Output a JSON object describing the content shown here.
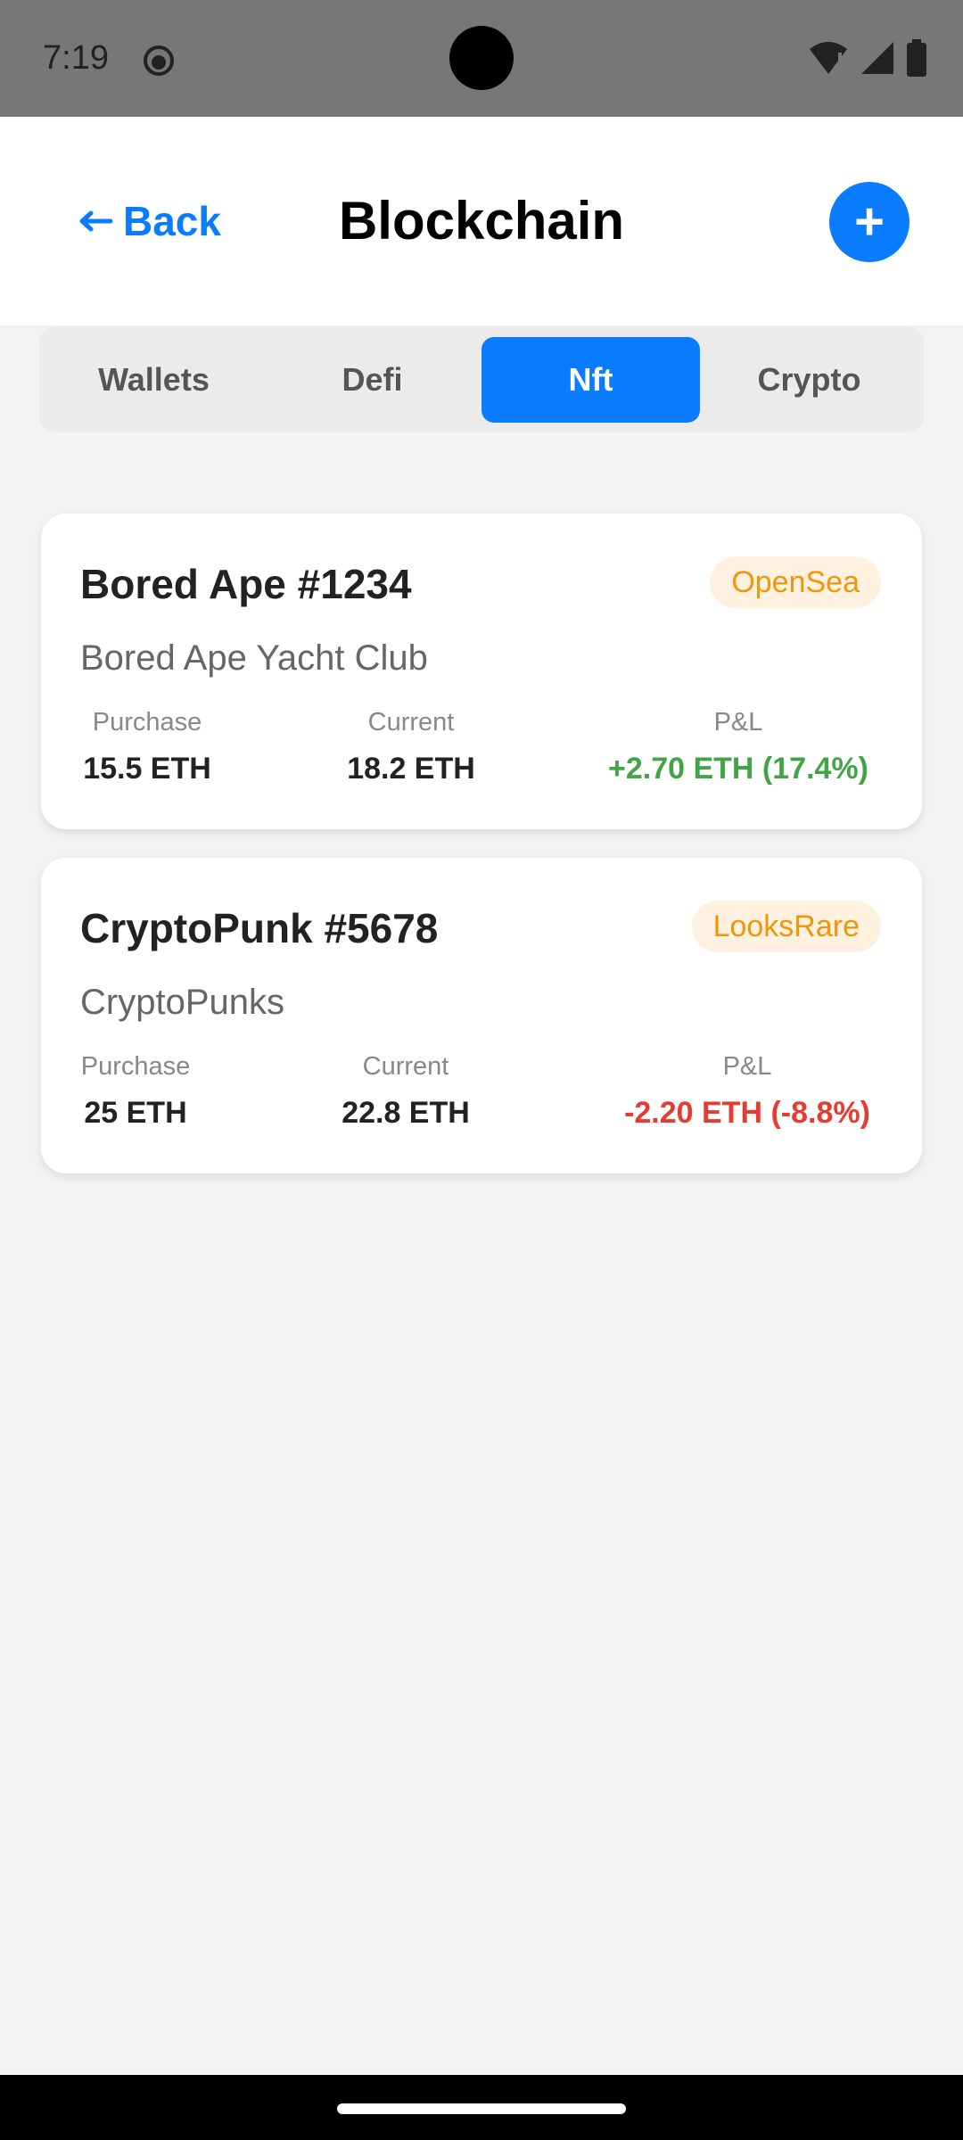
{
  "status_bar": {
    "time": "7:19"
  },
  "header": {
    "back_label": "Back",
    "title": "Blockchain",
    "add_label": "+"
  },
  "tabs": [
    {
      "label": "Wallets",
      "active": false
    },
    {
      "label": "Defi",
      "active": false
    },
    {
      "label": "Nft",
      "active": true
    },
    {
      "label": "Crypto",
      "active": false
    }
  ],
  "nfts": [
    {
      "name": "Bored Ape #1234",
      "marketplace": "OpenSea",
      "collection": "Bored Ape Yacht Club",
      "purchase_label": "Purchase",
      "purchase_value": "15.5 ETH",
      "current_label": "Current",
      "current_value": "18.2 ETH",
      "pnl_label": "P&L",
      "pnl_value": "+2.70 ETH (17.4%)",
      "pnl_color": "#43a447"
    },
    {
      "name": "CryptoPunk #5678",
      "marketplace": "LooksRare",
      "collection": "CryptoPunks",
      "purchase_label": "Purchase",
      "purchase_value": "25 ETH",
      "current_label": "Current",
      "current_value": "22.8 ETH",
      "pnl_label": "P&L",
      "pnl_value": "-2.20 ETH (-8.8%)",
      "pnl_color": "#e53b30"
    }
  ],
  "colors": {
    "accent": "#0a7cff",
    "badge_bg": "#fff1df",
    "badge_text": "#f0960a"
  }
}
